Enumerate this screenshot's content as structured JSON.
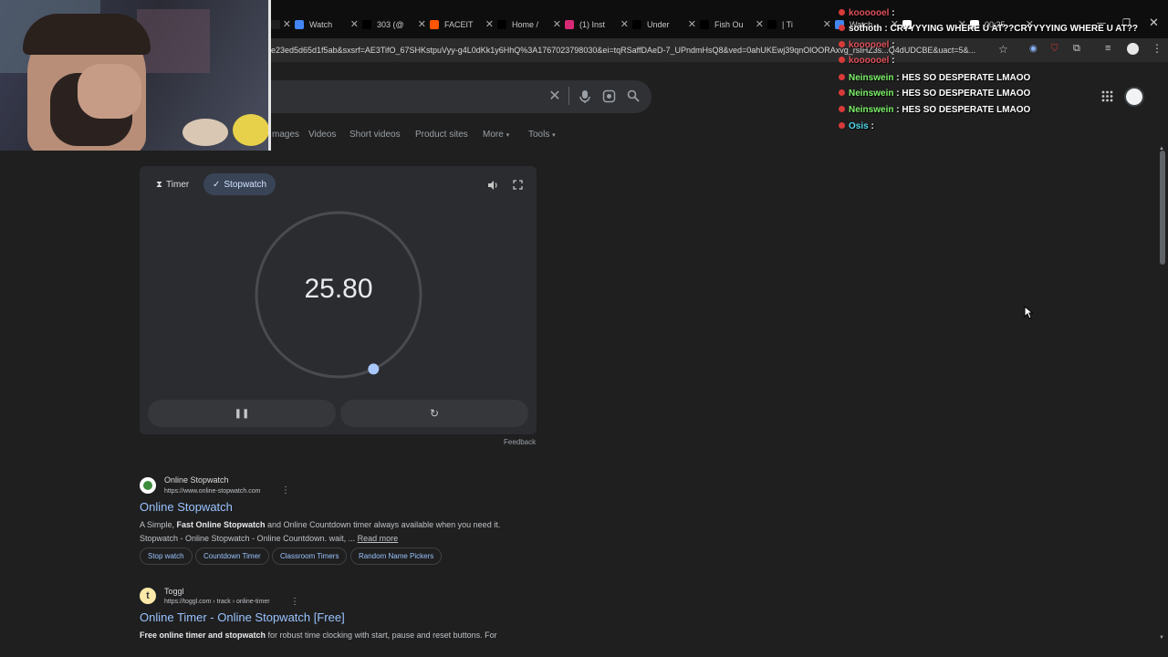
{
  "tabs": [
    {
      "label": "",
      "fav": "tab-icon",
      "color": "#1f1f1f"
    },
    {
      "label": "Watch",
      "fav": "watch-icon",
      "color": "#4285f4"
    },
    {
      "label": "303 (@",
      "fav": "tiktok-icon",
      "color": "#000000"
    },
    {
      "label": "FACEIT",
      "fav": "faceit-icon",
      "color": "#ff5500"
    },
    {
      "label": "Home /",
      "fav": "x-icon",
      "color": "#000000"
    },
    {
      "label": "(1) Inst",
      "fav": "instagram-icon",
      "color": "#d62976"
    },
    {
      "label": "Under",
      "fav": "tiktok-icon",
      "color": "#000000"
    },
    {
      "label": "Fish Ou",
      "fav": "tiktok-icon",
      "color": "#000000"
    },
    {
      "label": "| Ti",
      "fav": "tiktok-icon",
      "color": "#000000"
    },
    {
      "label": "Watch",
      "fav": "watch-icon",
      "color": "#4285f4"
    },
    {
      "label": "",
      "fav": "google-icon",
      "color": "#ffffff"
    },
    {
      "label": "00:25",
      "fav": "google-icon",
      "color": "#ffffff"
    }
  ],
  "address_bar": {
    "url": "e23ed5d65d1f5ab&sxsrf=AE3TifO_67SHKstpuVyy-g4L0dKk1y6HhQ%3A1767023798030&ei=tqRSaffDAeD-7_UPndmHsQ8&ved=0ahUKEwj39qnOlOORAxvg_rsIHZ3s...Q4dUDCBE&uact=5&..."
  },
  "search_tabs": [
    "mages",
    "Videos",
    "Short videos",
    "Product sites",
    "More",
    "Tools"
  ],
  "stopwatch": {
    "timer_label": "Timer",
    "stopwatch_label": "Stopwatch",
    "time": "25.80",
    "feedback": "Feedback",
    "progress": 0.43
  },
  "results": [
    {
      "site": "Online Stopwatch",
      "url": "https://www.online-stopwatch.com",
      "title": "Online Stopwatch",
      "snippet1_a": "A Simple, ",
      "snippet1_b": "Fast Online Stopwatch",
      "snippet1_c": " and Online Countdown timer always available when you need it.",
      "snippet2": "Stopwatch - Online Stopwatch - Online Countdown. wait, ...",
      "read_more": "Read more",
      "pills": [
        "Stop watch",
        "Countdown Timer",
        "Classroom Timers",
        "Random Name Pickers"
      ]
    },
    {
      "site": "Toggl",
      "url": "https://toggl.com › track › online-timer",
      "title": "Online Timer - Online Stopwatch [Free]",
      "snippet_b": "Free online timer and stopwatch",
      "snippet_c": " for robust time clocking with start, pause and reset buttons. For"
    }
  ],
  "chat": [
    {
      "user": "koooooel",
      "msg": "",
      "color": "#e0505a"
    },
    {
      "user": "sothoth",
      "msg": "CRYYYYING WHERE U AT??CRYYYYING WHERE U AT??",
      "color": "#ffffff"
    },
    {
      "user": "koooooel",
      "msg": "",
      "color": "#e0505a"
    },
    {
      "user": "koooooel",
      "msg": "",
      "color": "#e0505a"
    },
    {
      "user": "Neinswein",
      "msg": "HES SO DESPERATE LMAOO",
      "color": "#7cf069"
    },
    {
      "user": "Neinswein",
      "msg": "HES SO DESPERATE LMAOO",
      "color": "#7cf069"
    },
    {
      "user": "Neinswein",
      "msg": "HES SO DESPERATE LMAOO",
      "color": "#7cf069"
    },
    {
      "user": "Osis",
      "msg": "",
      "color": "#4fd6e8"
    }
  ]
}
